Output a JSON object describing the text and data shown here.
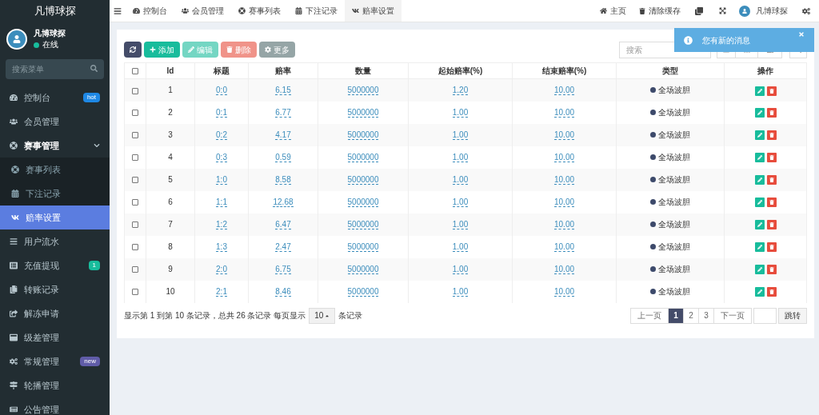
{
  "sidebar": {
    "brand": "凡博球探",
    "user": {
      "name": "凡博球探",
      "status": "在线",
      "online": true
    },
    "search": {
      "placeholder": "搜索菜单"
    },
    "menu": [
      {
        "label": "控制台",
        "selected": false,
        "badge": {
          "text": "hot",
          "color": "#1e88e5"
        }
      },
      {
        "label": "会员管理",
        "selected": false
      },
      {
        "label": "赛事管理",
        "selected": false,
        "expanded": true,
        "children": [
          {
            "label": "赛事列表",
            "selected": false
          },
          {
            "label": "下注记录",
            "selected": false
          },
          {
            "label": "赔率设置",
            "selected": true
          }
        ]
      },
      {
        "label": "用户流水",
        "selected": false
      },
      {
        "label": "充值提现",
        "selected": false,
        "badge": {
          "text": "1",
          "color": "#18bc9c"
        }
      },
      {
        "label": "转账记录",
        "selected": false
      },
      {
        "label": "解冻申请",
        "selected": false
      },
      {
        "label": "级差管理",
        "selected": false
      },
      {
        "label": "常规管理",
        "selected": false,
        "badge": {
          "text": "new",
          "color": "#605ca8"
        }
      },
      {
        "label": "轮播管理",
        "selected": false
      },
      {
        "label": "公告管理",
        "selected": false
      }
    ]
  },
  "header": {
    "tabs": [
      {
        "label": "控制台",
        "selected": false
      },
      {
        "label": "会员管理",
        "selected": false
      },
      {
        "label": "赛事列表",
        "selected": false
      },
      {
        "label": "下注记录",
        "selected": false
      },
      {
        "label": "赔率设置",
        "selected": true
      }
    ],
    "links": [
      "主页",
      "清除缓存"
    ],
    "user_name": "凡博球探"
  },
  "toolbar": {
    "buttons": [
      {
        "kind": "refresh",
        "disabled": false
      },
      {
        "kind": "add",
        "label": "添加",
        "disabled": false
      },
      {
        "kind": "edit",
        "label": "编辑",
        "disabled": true
      },
      {
        "kind": "delete",
        "label": "删除",
        "disabled": true
      },
      {
        "kind": "more",
        "label": "更多",
        "disabled": false
      }
    ],
    "search": {
      "placeholder": "搜索"
    }
  },
  "toast": {
    "message": "您有新的消息"
  },
  "table": {
    "all_checked": false,
    "columns": [
      "Id",
      "标题",
      "赔率",
      "数量",
      "起始赔率(%)",
      "结束赔率(%)",
      "类型",
      "操作"
    ],
    "rows": [
      {
        "checked": false,
        "cells": [
          "1",
          "0:0",
          "6.15",
          "5000000",
          "1.20",
          "10.00",
          "全场波胆"
        ]
      },
      {
        "checked": false,
        "cells": [
          "2",
          "0:1",
          "6.77",
          "5000000",
          "1.00",
          "10.00",
          "全场波胆"
        ]
      },
      {
        "checked": false,
        "cells": [
          "3",
          "0:2",
          "4.17",
          "5000000",
          "1.00",
          "10.00",
          "全场波胆"
        ]
      },
      {
        "checked": false,
        "cells": [
          "4",
          "0:3",
          "0.59",
          "5000000",
          "1.00",
          "10.00",
          "全场波胆"
        ]
      },
      {
        "checked": false,
        "cells": [
          "5",
          "1:0",
          "8.58",
          "5000000",
          "1.00",
          "10.00",
          "全场波胆"
        ]
      },
      {
        "checked": false,
        "cells": [
          "6",
          "1:1",
          "12.68",
          "5000000",
          "1.00",
          "10.00",
          "全场波胆"
        ]
      },
      {
        "checked": false,
        "cells": [
          "7",
          "1:2",
          "6.47",
          "5000000",
          "1.00",
          "10.00",
          "全场波胆"
        ]
      },
      {
        "checked": false,
        "cells": [
          "8",
          "1:3",
          "2.47",
          "5000000",
          "1.00",
          "10.00",
          "全场波胆"
        ]
      },
      {
        "checked": false,
        "cells": [
          "9",
          "2:0",
          "6.75",
          "5000000",
          "1.00",
          "10.00",
          "全场波胆"
        ]
      },
      {
        "checked": false,
        "cells": [
          "10",
          "2:1",
          "8.46",
          "5000000",
          "1.00",
          "10.00",
          "全场波胆"
        ]
      }
    ]
  },
  "pagination": {
    "summary": "显示第 1 到第 10 条记录，总共 26 条记录 每页显示",
    "page_size": "10",
    "suffix": "条记录",
    "prev": "上一页",
    "pages": [
      {
        "label": "1",
        "selected": true
      },
      {
        "label": "2",
        "selected": false
      },
      {
        "label": "3",
        "selected": false
      }
    ],
    "next": "下一页",
    "jump": "跳转"
  }
}
